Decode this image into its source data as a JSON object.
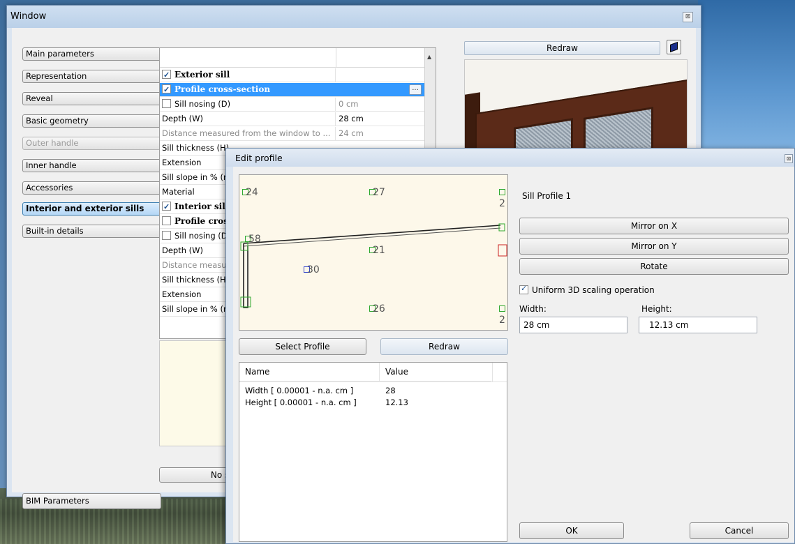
{
  "window": {
    "title": "Window",
    "close_glyph": "⊠",
    "sidebar": [
      {
        "label": "Main parameters",
        "state": "normal"
      },
      {
        "label": "Representation",
        "state": "normal"
      },
      {
        "label": "Reveal",
        "state": "normal"
      },
      {
        "label": "Basic geometry",
        "state": "normal"
      },
      {
        "label": "Outer handle",
        "state": "disabled"
      },
      {
        "label": "Inner handle",
        "state": "normal"
      },
      {
        "label": "Accessories",
        "state": "normal"
      },
      {
        "label": "Interior and exterior sills",
        "state": "active"
      },
      {
        "label": "Built-in details",
        "state": "normal"
      }
    ],
    "properties": [
      {
        "name": "Exterior sill",
        "value": "",
        "type": "header",
        "checked": true
      },
      {
        "name": "Profile cross-section",
        "value": "",
        "type": "selected",
        "checked": true
      },
      {
        "name": "Sill nosing (D)",
        "value": "0 cm",
        "type": "check",
        "checked": false
      },
      {
        "name": "Depth (W)",
        "value": "28 cm",
        "type": "normal"
      },
      {
        "name": "Distance measured from the window to ...",
        "value": "24 cm",
        "type": "gray"
      },
      {
        "name": "Sill thickness (H)",
        "value": "",
        "type": "normal"
      },
      {
        "name": "Extension",
        "value": "",
        "type": "normal"
      },
      {
        "name": "Sill slope in % (min",
        "value": "",
        "type": "normal"
      },
      {
        "name": "Material",
        "value": "",
        "type": "normal"
      },
      {
        "name": "Interior sill",
        "value": "",
        "type": "header",
        "checked": true
      },
      {
        "name": "Profile cross",
        "value": "",
        "type": "header",
        "checked": false
      },
      {
        "name": "Sill nosing (D)",
        "value": "",
        "type": "check",
        "checked": false
      },
      {
        "name": "Depth (W)",
        "value": "",
        "type": "normal"
      },
      {
        "name": "Distance measure",
        "value": "",
        "type": "gray"
      },
      {
        "name": "Sill thickness (H)",
        "value": "",
        "type": "normal"
      },
      {
        "name": "Extension",
        "value": "",
        "type": "normal"
      },
      {
        "name": "Sill slope in % (mi",
        "value": "",
        "type": "normal"
      }
    ],
    "ellipsis": "...",
    "redraw": "Redraw",
    "bim_parameters": "BIM Parameters",
    "no_style": "No st"
  },
  "edit_profile": {
    "title": "Edit profile",
    "close_glyph": "⊠",
    "profile_name": "Sill Profile 1",
    "points": [
      {
        "label": "24"
      },
      {
        "label": "27"
      },
      {
        "label": "58"
      },
      {
        "label": "21"
      },
      {
        "label": "30"
      },
      {
        "label": "26"
      },
      {
        "label": "2"
      },
      {
        "label": "2"
      }
    ],
    "select_profile": "Select Profile",
    "redraw": "Redraw",
    "mirror_x": "Mirror on X",
    "mirror_y": "Mirror on Y",
    "rotate": "Rotate",
    "uniform_scaling": "Uniform 3D scaling operation",
    "uniform_checked": true,
    "width_label": "Width:",
    "height_label": "Height:",
    "width_value": "28 cm",
    "height_value": "12.13 cm",
    "table": {
      "headers": [
        "Name",
        "Value"
      ],
      "rows": [
        {
          "name": "Width [ 0.00001 - n.a. cm ]",
          "value": "28"
        },
        {
          "name": "Height [ 0.00001 - n.a. cm ]",
          "value": "12.13"
        }
      ]
    },
    "ok": "OK",
    "cancel": "Cancel"
  }
}
